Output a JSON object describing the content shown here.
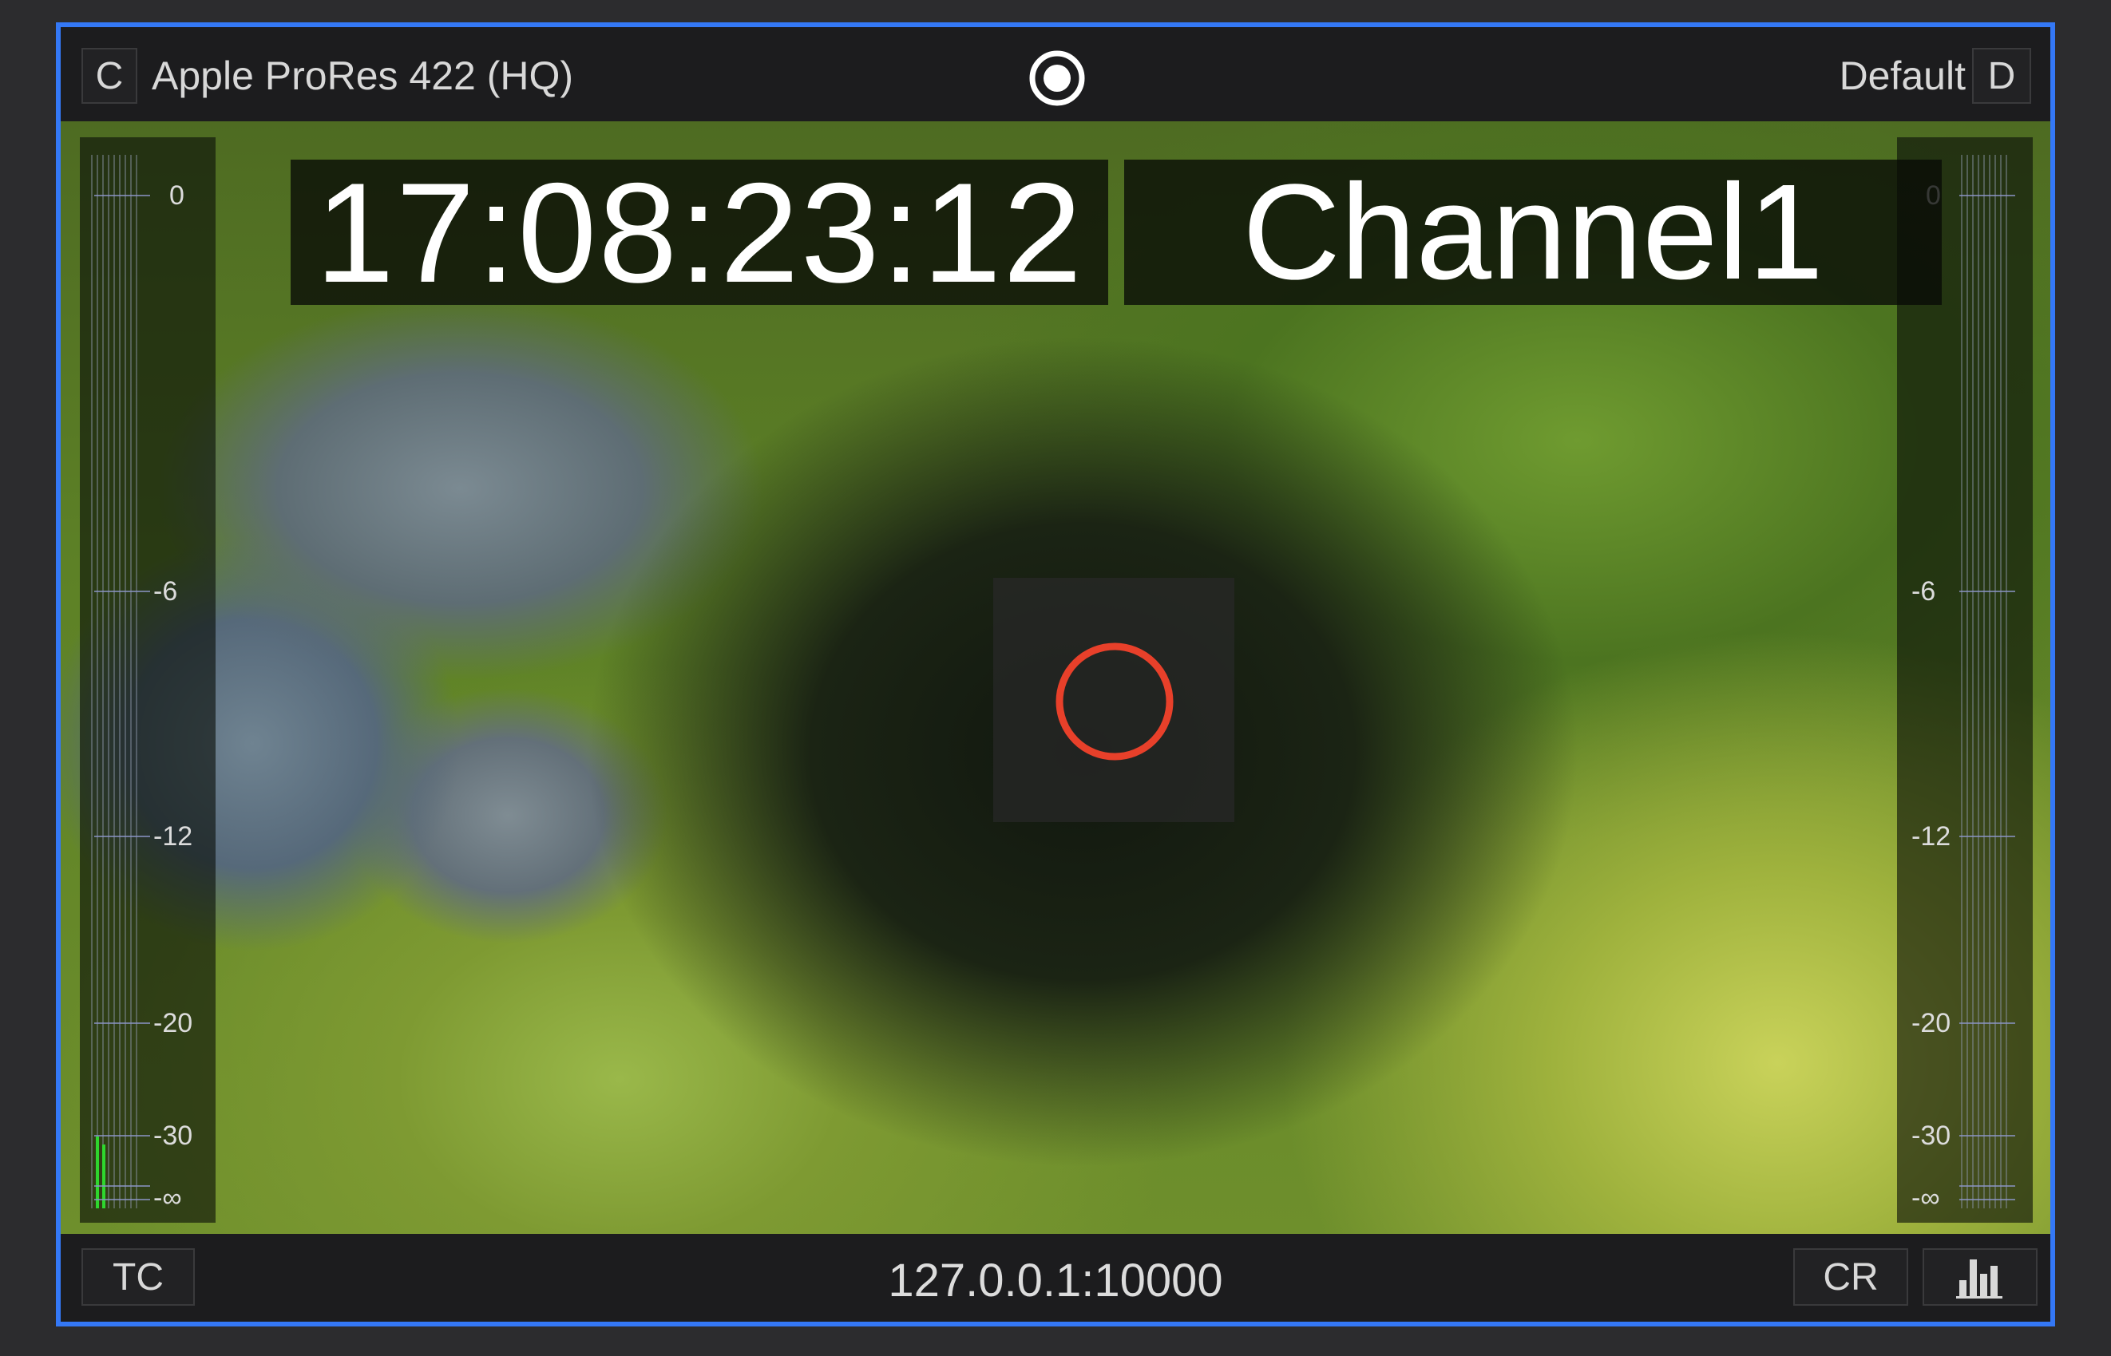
{
  "header": {
    "codec_button": "C",
    "codec_label": "Apple ProRes 422 (HQ)",
    "preset_label": "Default",
    "preset_button": "D",
    "record_icon": "record-icon"
  },
  "overlay": {
    "timecode": "17:08:23:12",
    "channel": "Channel1",
    "center_icon": "circle-outline-icon",
    "accent_color": "#e8402a"
  },
  "meters": {
    "scale": [
      "0",
      "-6",
      "-12",
      "-20",
      "-30",
      "-∞"
    ],
    "left_level_color": "#2ed62e"
  },
  "footer": {
    "tc_button": "TC",
    "address": "127.0.0.1:10000",
    "cr_button": "CR",
    "histogram_icon": "histogram-icon"
  },
  "colors": {
    "frame_border": "#3478f6",
    "bar_background": "#1c1c1e"
  }
}
